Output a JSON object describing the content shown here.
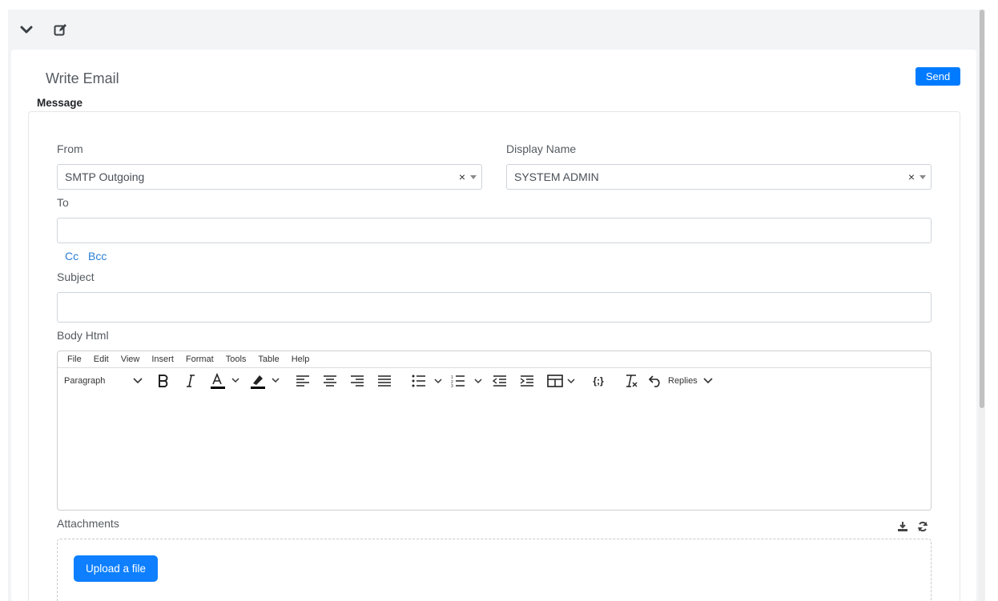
{
  "header": {
    "collapse_icon": "chevron-down-icon",
    "edit_icon": "edit-icon"
  },
  "page": {
    "title": "Write Email",
    "send_label": "Send",
    "section_label": "Message"
  },
  "form": {
    "from_label": "From",
    "from_value": "SMTP Outgoing",
    "display_name_label": "Display Name",
    "display_name_value": "SYSTEM ADMIN",
    "clear_symbol": "×",
    "to_label": "To",
    "to_value": "",
    "cc_label": "Cc",
    "bcc_label": "Bcc",
    "subject_label": "Subject",
    "subject_value": "",
    "body_label": "Body Html"
  },
  "editor": {
    "menus": [
      "File",
      "Edit",
      "View",
      "Insert",
      "Format",
      "Tools",
      "Table",
      "Help"
    ],
    "block_format": "Paragraph",
    "replies_label": "Replies",
    "variables_label": "{;}"
  },
  "attachments": {
    "label": "Attachments",
    "upload_label": "Upload a file",
    "download_icon": "download-icon",
    "refresh_icon": "refresh-icon"
  },
  "colors": {
    "primary": "#007bff",
    "link": "#2b7fd6"
  }
}
